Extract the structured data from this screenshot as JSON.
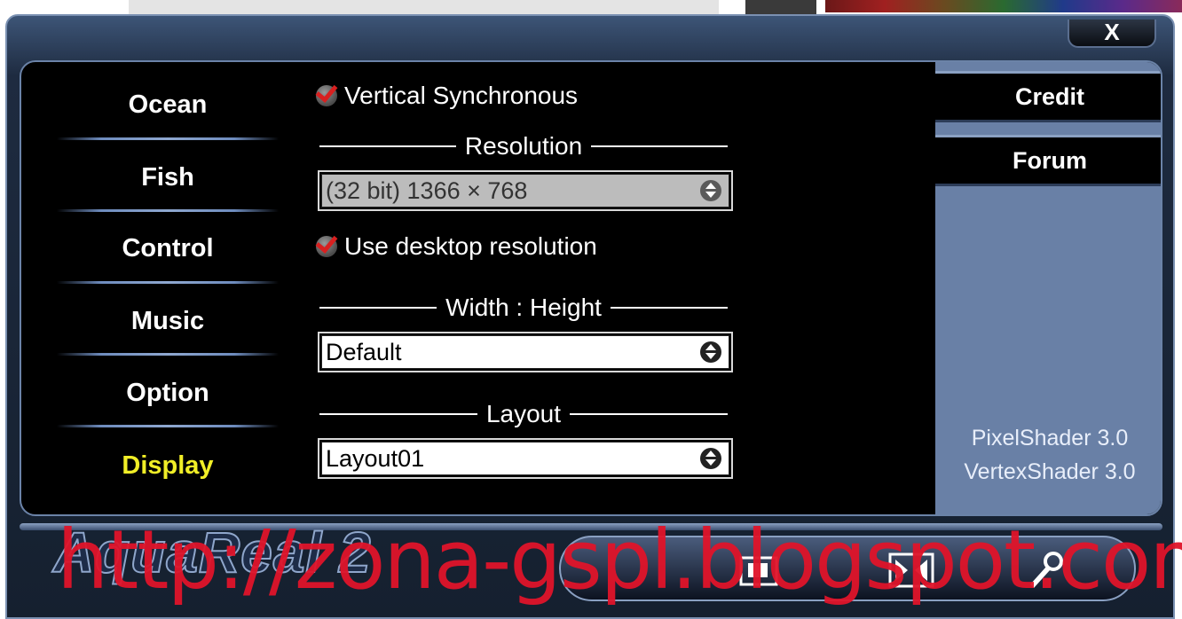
{
  "window": {
    "close_label": "X"
  },
  "nav": {
    "items": [
      {
        "label": "Ocean",
        "active": false
      },
      {
        "label": "Fish",
        "active": false
      },
      {
        "label": "Control",
        "active": false
      },
      {
        "label": "Music",
        "active": false
      },
      {
        "label": "Option",
        "active": false
      },
      {
        "label": "Display",
        "active": true
      }
    ]
  },
  "display": {
    "vsync_label": "Vertical Synchronous",
    "vsync_checked": true,
    "resolution_title": "Resolution",
    "resolution_value": "(32 bit) 1366 × 768",
    "resolution_enabled": false,
    "use_desktop_label": "Use desktop resolution",
    "use_desktop_checked": true,
    "aspect_title": "Width : Height",
    "aspect_value": "Default",
    "layout_title": "Layout",
    "layout_value": "Layout01"
  },
  "right_panel": {
    "credit_label": "Credit",
    "forum_label": "Forum",
    "pixel_shader": "PixelShader 3.0",
    "vertex_shader": "VertexShader 3.0"
  },
  "bottom": {
    "logo_text": "AquaReal 2",
    "watermark": "http://zona-gspl.blogspot.com",
    "tools": [
      "window-mode-icon",
      "fullscreen-icon",
      "settings-wrench-icon"
    ]
  },
  "colors": {
    "active_nav": "#f1ee27",
    "panel_blue": "#6980a6",
    "watermark_red": "#e0142a"
  }
}
